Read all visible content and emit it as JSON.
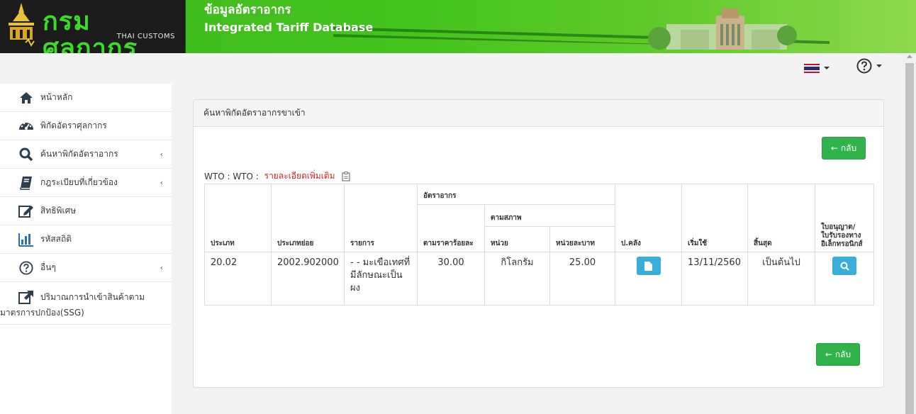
{
  "header": {
    "logo_text": "กรมศุลกากร",
    "logo_sub": "THAI CUSTOMS",
    "title": "ข้อมูลอัตราอากร",
    "subtitle": "Integrated Tariff Database"
  },
  "topbar": {
    "flag_icon": "thai-flag-icon",
    "help_icon": "question-circle-icon"
  },
  "sidebar": {
    "items": [
      {
        "label": "หน้าหลัก",
        "icon": "home-icon"
      },
      {
        "label": "พิกัดอัตราศุลกากร",
        "icon": "dashboard-icon"
      },
      {
        "label": "ค้นหาพิกัดอัตราอากร",
        "icon": "search-icon",
        "chevron": "‹"
      },
      {
        "label": "กฎระเบียบที่เกี่ยวข้อง",
        "icon": "book-icon",
        "chevron": "‹"
      },
      {
        "label": "สิทธิพิเศษ",
        "icon": "edit-icon"
      },
      {
        "label": "รหัสสถิติ",
        "icon": "bar-chart-icon"
      },
      {
        "label": "อื่นๆ",
        "icon": "question-circle-icon",
        "chevron": "‹"
      },
      {
        "label": "ปริมาณการนำเข้าสินค้าตาม",
        "label2": "มาตรการปกป้อง(SSG)",
        "icon": "external-link-icon"
      }
    ]
  },
  "panel": {
    "title": "ค้นหาพิกัดอัตราอากรขาเข้า",
    "back_label": "กลับ",
    "wto_prefix": "WTO : WTO : ",
    "wto_link": "รายละเอียดเพิ่มเติม"
  },
  "table": {
    "group_rate": "อัตราอากร",
    "group_specific": "ตามสภาพ",
    "headers": {
      "type": "ประเภท",
      "subtype": "ประเภทย่อย",
      "item": "รายการ",
      "adval": "ตามราคาร้อยละ",
      "unit": "หน่วย",
      "per_unit": "หน่วยละบาท",
      "notice": "ป.คลัง",
      "start": "เริ่มใช้",
      "end": "สิ้นสุด",
      "license": "ใบอนุญาต/ ใบรับรองทาง อิเล็กทรอนิกส์"
    },
    "rows": [
      {
        "type": "20.02",
        "subtype": "2002.902000",
        "item": "- - มะเขือเทศที่มีลักษณะเป็นผง",
        "adval": "30.00",
        "unit": "กิโลกรัม",
        "per_unit": "25.00",
        "start": "13/11/2560",
        "end": "เป็นต้นไป"
      }
    ]
  },
  "colors": {
    "header_green": "#45c41e",
    "button_green": "#2fb34a",
    "button_blue": "#3aaed8",
    "link_red": "#e02020"
  }
}
